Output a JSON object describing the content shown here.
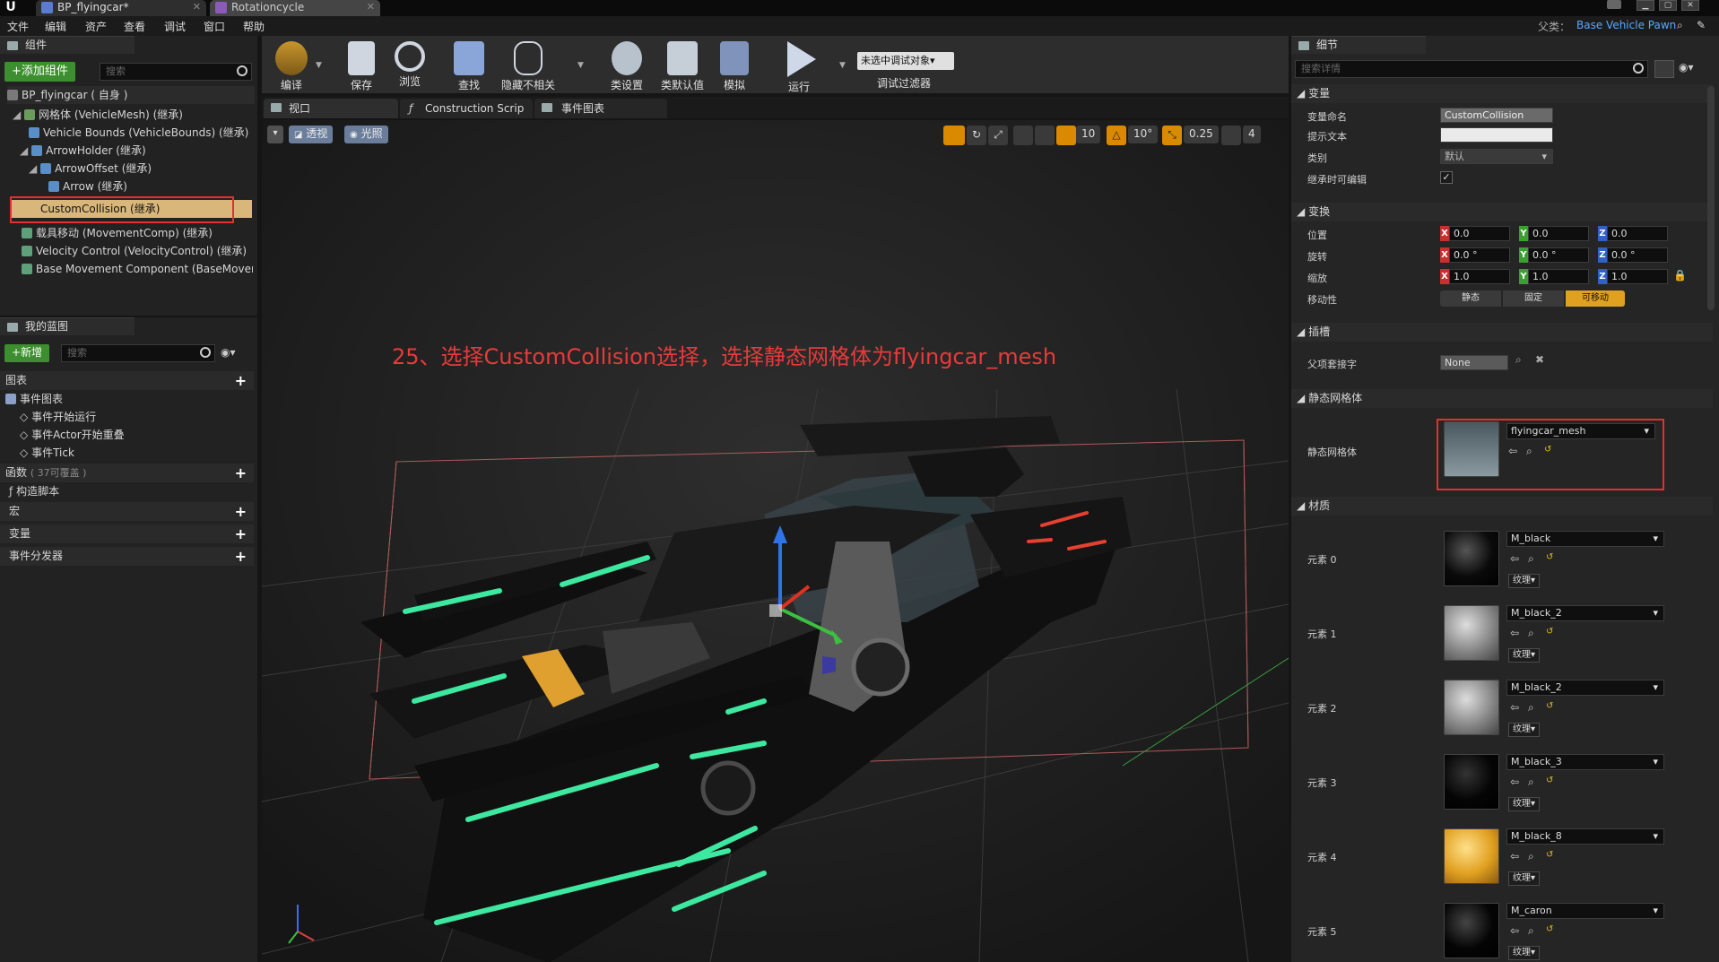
{
  "titlebar": {
    "tabs": [
      {
        "label": "BP_flyingcar*"
      },
      {
        "label": "Rotationcycle"
      }
    ]
  },
  "menubar": {
    "items": [
      "文件",
      "编辑",
      "资产",
      "查看",
      "调试",
      "窗口",
      "帮助"
    ],
    "parent_label": "父类：",
    "parent_value": "Base Vehicle Pawn"
  },
  "components": {
    "tab_label": "组件",
    "add_button": "+添加组件",
    "search_placeholder": "搜索",
    "self_label": "BP_flyingcar ( 自身 )",
    "tree": [
      {
        "label": "网格体 (VehicleMesh) (继承)"
      },
      {
        "label": "Vehicle Bounds (VehicleBounds) (继承)"
      },
      {
        "label": "ArrowHolder (继承)"
      },
      {
        "label": "ArrowOffset (继承)"
      },
      {
        "label": "Arrow (继承)"
      },
      {
        "label": "CustomCollision (继承)"
      },
      {
        "label": "载具移动 (MovementComp) (继承)"
      },
      {
        "label": "Velocity Control (VelocityControl) (继承)"
      },
      {
        "label": "Base Movement Component (BaseMovement"
      }
    ]
  },
  "my_blueprint": {
    "tab_label": "我的蓝图",
    "new_button": "+新增",
    "search_placeholder": "搜索",
    "graphs_label": "图表",
    "event_graph_label": "事件图表",
    "events": [
      "事件开始运行",
      "事件Actor开始重叠",
      "事件Tick"
    ],
    "functions_label": "函数",
    "functions_count": "( 37可覆盖 )",
    "construction_script": "构造脚本",
    "macros_label": "宏",
    "variables_label": "变量",
    "dispatchers_label": "事件分发器"
  },
  "toolbar": {
    "buttons": [
      "编译",
      "保存",
      "浏览",
      "查找",
      "隐藏不相关",
      "类设置",
      "类默认值",
      "模拟",
      "运行"
    ],
    "debug_dropdown": "未选中调试对象",
    "debug_filter": "调试过滤器"
  },
  "editor_tabs": [
    "视口",
    "Construction Scrip",
    "事件图表"
  ],
  "viewport": {
    "perspective": "透视",
    "lit": "光照",
    "grid_snap": "10",
    "rot_snap": "10°",
    "scale_snap": "0.25",
    "cam_speed": "4",
    "annotation": "25、选择CustomCollision选择，选择静态网格体为flyingcar_mesh"
  },
  "details": {
    "tab_label": "细节",
    "search_placeholder": "搜索详情",
    "variables_section": "变量",
    "var_name_label": "变量命名",
    "var_name_value": "CustomCollision",
    "tooltip_label": "提示文本",
    "category_label": "类别",
    "category_value": "默认",
    "editable_label": "继承时可编辑",
    "transform_section": "变换",
    "location_label": "位置",
    "rotation_label": "旋转",
    "scale_label": "缩放",
    "mobility_label": "移动性",
    "location": [
      "0.0",
      "0.0",
      "0.0"
    ],
    "rotation": [
      "0.0 °",
      "0.0 °",
      "0.0 °"
    ],
    "scale": [
      "1.0",
      "1.0",
      "1.0"
    ],
    "mobility_options": [
      "静态",
      "固定",
      "可移动"
    ],
    "sockets_section": "插槽",
    "parent_socket_label": "父项套接字",
    "parent_socket_value": "None",
    "static_mesh_section": "静态网格体",
    "static_mesh_label": "静态网格体",
    "static_mesh_value": "flyingcar_mesh",
    "materials_section": "材质",
    "texture_btn": "纹理",
    "materials": [
      {
        "label": "元素 0",
        "name": "M_black"
      },
      {
        "label": "元素 1",
        "name": "M_black_2"
      },
      {
        "label": "元素 2",
        "name": "M_black_2"
      },
      {
        "label": "元素 3",
        "name": "M_black_3"
      },
      {
        "label": "元素 4",
        "name": "M_black_8"
      },
      {
        "label": "元素 5",
        "name": "M_caron"
      }
    ]
  },
  "colors": {
    "accent_green": "#3c8f2e",
    "highlight_red": "#e03030",
    "selected_row": "#d9b77a",
    "annotation_red": "#e83a3a"
  }
}
